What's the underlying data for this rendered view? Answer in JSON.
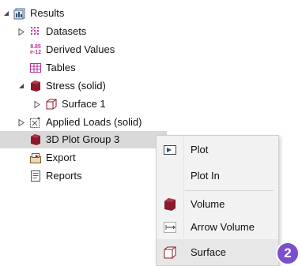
{
  "tree": {
    "results": {
      "label": "Results",
      "icon": "results-icon"
    },
    "datasets": {
      "label": "Datasets",
      "icon": "datasets-icon"
    },
    "derived_values": {
      "label": "Derived Values",
      "icon": "derived-values-icon",
      "icon_text_top": "8.85",
      "icon_text_bottom": "e-12"
    },
    "tables": {
      "label": "Tables",
      "icon": "table-icon"
    },
    "stress": {
      "label": "Stress (solid)",
      "icon": "plot-group-icon"
    },
    "surface1": {
      "label": "Surface 1",
      "icon": "surface-plot-icon"
    },
    "applied_loads": {
      "label": "Applied Loads (solid)",
      "icon": "applied-loads-icon"
    },
    "plot_group3": {
      "label": "3D Plot Group 3",
      "icon": "plot-group-icon"
    },
    "export": {
      "label": "Export",
      "icon": "export-icon"
    },
    "reports": {
      "label": "Reports",
      "icon": "reports-icon"
    }
  },
  "context_menu": {
    "items": [
      {
        "label": "Plot",
        "icon": "plot-icon"
      },
      {
        "label": "Plot In",
        "icon": ""
      },
      {
        "label": "Volume",
        "icon": "volume-icon"
      },
      {
        "label": "Arrow Volume",
        "icon": "arrow-volume-icon"
      },
      {
        "label": "Surface",
        "icon": "surface-icon"
      }
    ]
  },
  "badge": {
    "text": "2"
  },
  "colors": {
    "plot_group": "#8b1a2b",
    "accent": "#7a4fc9",
    "selection": "#d9d9d9"
  }
}
